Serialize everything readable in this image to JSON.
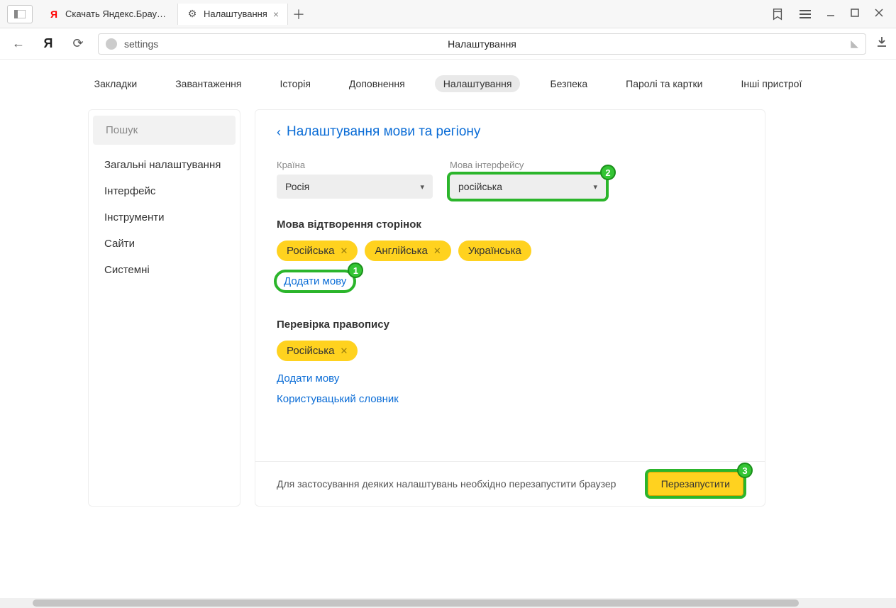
{
  "tabs": [
    {
      "title": "Скачать Яндекс.Браузер д"
    },
    {
      "title": "Налаштування"
    }
  ],
  "address": {
    "text": "settings",
    "center_label": "Налаштування"
  },
  "secnav": {
    "bookmarks": "Закладки",
    "downloads": "Завантаження",
    "history": "Історія",
    "addons": "Доповнення",
    "settings": "Налаштування",
    "security": "Безпека",
    "passwords": "Паролі та картки",
    "devices": "Інші пристрої"
  },
  "sidebar": {
    "search_placeholder": "Пошук",
    "items": [
      "Загальні налаштування",
      "Інтерфейс",
      "Інструменти",
      "Сайти",
      "Системні"
    ]
  },
  "main": {
    "title": "Налаштування мови та регіону",
    "country_label": "Країна",
    "country_value": "Росія",
    "lang_label": "Мова інтерфейсу",
    "lang_value": "російська",
    "page_lang_title": "Мова відтворення сторінок",
    "page_lang_chips": [
      "Російська",
      "Англійська",
      "Українська"
    ],
    "add_lang": "Додати мову",
    "spell_title": "Перевірка правопису",
    "spell_chips": [
      "Російська"
    ],
    "add_lang2": "Додати мову",
    "user_dict": "Користувацький словник",
    "footer_text": "Для застосування деяких налаштувань необхідно перезапустити браузер",
    "restart": "Перезапустити"
  },
  "callouts": {
    "one": "1",
    "two": "2",
    "three": "3"
  }
}
